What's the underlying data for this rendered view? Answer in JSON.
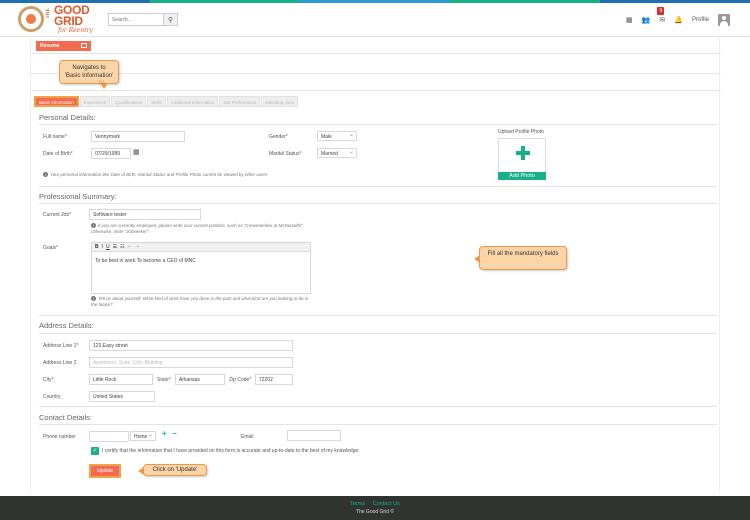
{
  "brand": {
    "stripe_colors": [
      "#1f6fb2",
      "#1aaf8b",
      "#2a9ad6",
      "#1aaf8b",
      "#1f6fb2"
    ],
    "accent": "#f26b4f",
    "teal": "#1aaf8b",
    "logo_the": "THE",
    "logo_main_1": "GOOD",
    "logo_main_2": "GRID",
    "logo_sub": "for Reentry"
  },
  "header": {
    "search_placeholder": "Search...",
    "search_icon": "magnifier-icon",
    "notification_count": "9",
    "profile_label": "Profile"
  },
  "resume_tab": {
    "label": "Resume"
  },
  "tooltips": {
    "basic_info": "Navigates to 'Basic Information'",
    "basic_info_num": "(1)",
    "mandatory": "Fill all the mandatory fields",
    "update": "Click on 'Update'"
  },
  "tabs": [
    {
      "label": "Basic Information",
      "active": true
    },
    {
      "label": "Experience"
    },
    {
      "label": "Qualifications"
    },
    {
      "label": "Skills"
    },
    {
      "label": "Additional Information"
    },
    {
      "label": "Job Preferences"
    },
    {
      "label": "Matching Jobs"
    }
  ],
  "personal": {
    "title": "Personal Details:",
    "full_name_label": "Full name",
    "full_name_value": "Vennymark",
    "dob_label": "Date of Birth",
    "dob_value": "07/29/1989",
    "gender_label": "Gender",
    "gender_value": "Male",
    "marital_label": "Marital Status",
    "marital_value": "Married",
    "privacy_note": "Your personal information like Date of Birth, Marital Status and Profile Photo cannot be viewed by other users",
    "photo_label": "Upload Profile Photo",
    "photo_button": "Add Photo"
  },
  "professional": {
    "title": "Professional Summary:",
    "job_label": "Current Job",
    "job_value": "Software tester",
    "job_note": "If you are currently employed, please write your current position, such as \"Crewmember at McDonalds\". Otherwise, write \"Jobseeker\".",
    "goals_label": "Goals",
    "goals_value": "To be best in work.To become a CEO of MNC",
    "goals_note": "Tell us about yourself: What kind of work have you done in the past and what kind are you looking to do in the future?",
    "toolbar": [
      "B",
      "I",
      "U",
      "☰",
      "☷",
      "⇤",
      "⇥"
    ]
  },
  "address": {
    "title": "Address Details:",
    "line1_label": "Address Line 1",
    "line1_value": "123,Easy street",
    "line2_label": "Address Line 2",
    "line2_placeholder": "Apartment, Suite, Unit, Building",
    "city_label": "City",
    "city_value": "Little Rock",
    "state_label": "State",
    "state_value": "Arkansas",
    "zip_label": "Zip Code",
    "zip_value": "72202",
    "country_label": "Country",
    "country_value": "United States"
  },
  "contact": {
    "title": "Contact Details:",
    "phone_label": "Phone number",
    "phone_type": "Home",
    "email_label": "Email",
    "certify_text": "I certify that the information that I have provided on this form is accurate and up-to-date to the best of my knowledge.",
    "update_button": "Update"
  },
  "footer": {
    "terms": "Terms",
    "contact": "Contact Us",
    "copyright": "The Good Grid ©"
  }
}
